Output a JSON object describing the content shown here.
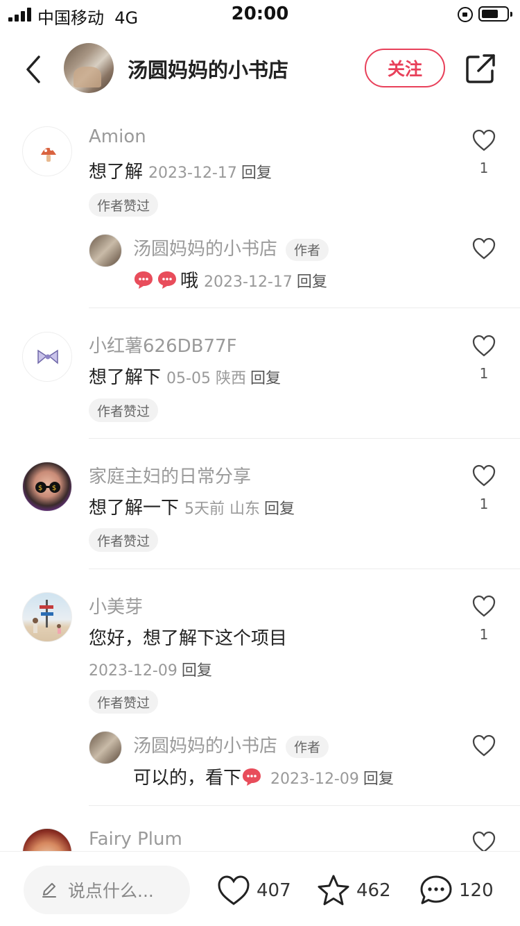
{
  "status_bar": {
    "carrier": "中国移动",
    "network": "4G",
    "time": "20:00"
  },
  "header": {
    "title": "汤圆妈妈的小书店",
    "follow_label": "关注"
  },
  "comments": [
    {
      "username": "Amion",
      "text": "想了解",
      "date": "2023-12-17",
      "reply_label": "回复",
      "like_count": "1",
      "tag": "作者赞过",
      "reply": {
        "username": "汤圆妈妈的小书店",
        "author_tag": "作者",
        "text": "哦",
        "date": "2023-12-17",
        "reply_label": "回复"
      }
    },
    {
      "username": "小红薯626DB77F",
      "text": "想了解下",
      "date": "05-05",
      "location": "陕西",
      "reply_label": "回复",
      "like_count": "1",
      "tag": "作者赞过"
    },
    {
      "username": "家庭主妇的日常分享",
      "text": "想了解一下",
      "date": "5天前",
      "location": "山东",
      "reply_label": "回复",
      "like_count": "1",
      "tag": "作者赞过"
    },
    {
      "username": "小美芽",
      "text": "您好，想了解下这个项目",
      "date": "2023-12-09",
      "reply_label": "回复",
      "like_count": "1",
      "tag": "作者赞过",
      "reply": {
        "username": "汤圆妈妈的小书店",
        "author_tag": "作者",
        "text": "可以的，看下",
        "date": "2023-12-09",
        "reply_label": "回复"
      }
    },
    {
      "username": "Fairy Plum"
    }
  ],
  "bottom_bar": {
    "input_placeholder": "说点什么...",
    "likes": "407",
    "stars": "462",
    "comments": "120"
  },
  "colors": {
    "accent": "#e8405a",
    "muted_text": "#999999"
  },
  "icons": [
    "back-icon",
    "share-icon",
    "heart-icon",
    "star-icon",
    "comment-icon",
    "pen-icon",
    "speech-bubble-emoji"
  ]
}
